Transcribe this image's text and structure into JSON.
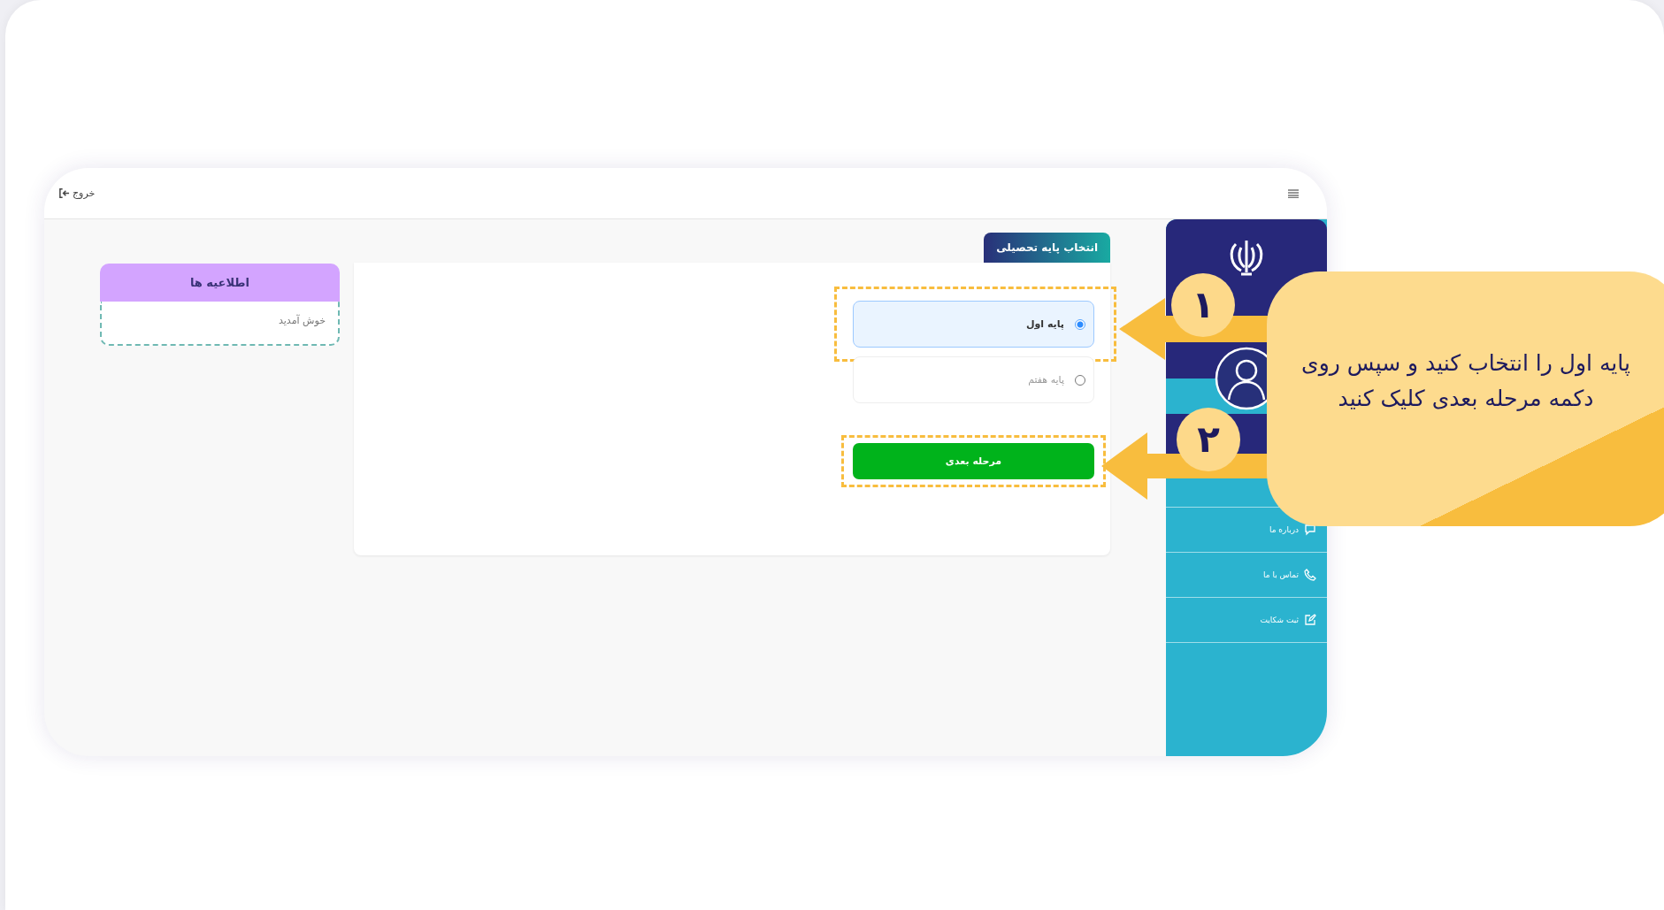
{
  "topbar": {
    "logout_label": "خروج"
  },
  "selection": {
    "tab": "انتخاب پایه تحصیلی",
    "options": [
      {
        "label": "پایه اول",
        "selected": true,
        "highlighted": true
      },
      {
        "label": "پایه هفتم",
        "selected": false,
        "highlighted": false
      }
    ],
    "next_button": {
      "label": "مرحله بعدی",
      "highlighted": true
    }
  },
  "notices": {
    "title": "اطلاعیه ها",
    "items": [
      "خوش آمدید"
    ]
  },
  "sidebar": {
    "items": [
      {
        "label": "درباره ما",
        "kind": "chat"
      },
      {
        "label": "تماس با ما",
        "kind": "phone"
      },
      {
        "label": "ثبت شکایت",
        "kind": "edit"
      }
    ]
  },
  "guide": {
    "steps": [
      "۱",
      "۲"
    ],
    "callout": "پایه اول را انتخاب کنید و سپس روی دکمه مرحله بعدی کلیک کنید"
  }
}
